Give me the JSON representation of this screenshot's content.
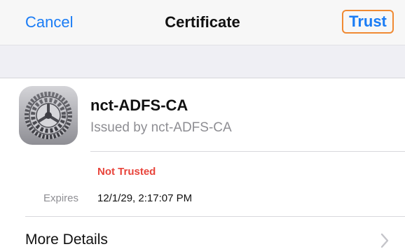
{
  "navbar": {
    "cancel_label": "Cancel",
    "title": "Certificate",
    "trust_label": "Trust"
  },
  "certificate": {
    "name": "nct-ADFS-CA",
    "issued_by": "Issued by nct-ADFS-CA",
    "icon": "settings-gear-icon",
    "status": "Not Trusted",
    "expires_label": "Expires",
    "expires_value": "12/1/29, 2:17:07 PM"
  },
  "more_details": {
    "label": "More Details",
    "icon": "chevron-right-icon"
  },
  "colors": {
    "accent": "#1a7cf5",
    "highlight_border": "#f08a33",
    "status_red": "#e8443b",
    "secondary_text": "#8e8e93",
    "band_gray": "#efeff4"
  }
}
